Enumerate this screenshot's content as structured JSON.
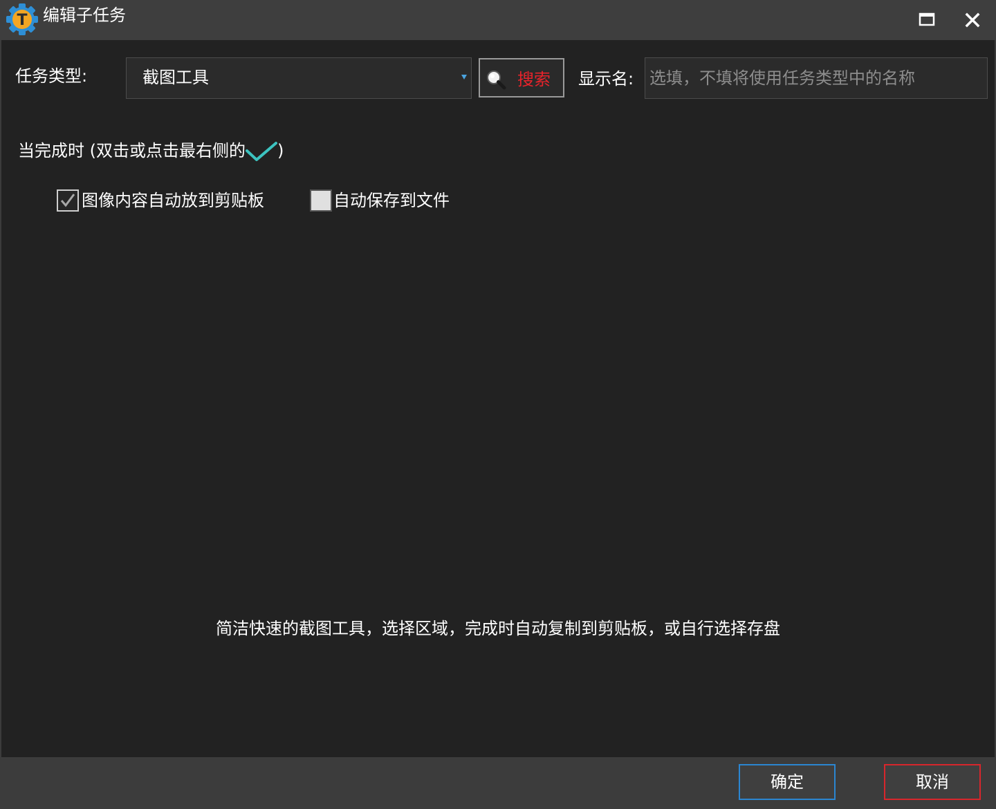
{
  "window": {
    "title": "编辑子任务",
    "app_icon": "t-gear-app-icon",
    "app_icon_letter": "T",
    "controls": {
      "maximize_icon": "maximize-icon",
      "close_icon": "close-icon"
    }
  },
  "form": {
    "task_type_label": "任务类型:",
    "task_type_value": "截图工具",
    "search_label": "搜索",
    "display_name_label": "显示名:",
    "display_name_value": "",
    "display_name_placeholder": "选填，不填将使用任务类型中的名称"
  },
  "completion": {
    "heading_prefix": "当完成时 (双击或点击最右侧的",
    "heading_suffix": ")",
    "options": [
      {
        "label": "图像内容自动放到剪贴板",
        "checked": true
      },
      {
        "label": "自动保存到文件",
        "checked": false
      }
    ]
  },
  "description": "简洁快速的截图工具，选择区域，完成时自动复制到剪贴板，或自行选择存盘",
  "footer": {
    "ok_label": "确定",
    "cancel_label": "取消"
  },
  "colors": {
    "accent_blue": "#2b86d1",
    "danger_red": "#d8262c",
    "search_text_red": "#e8232b",
    "check_teal": "#3cc3c0",
    "content_bg": "#222222",
    "chrome_bg": "#3c3c3c"
  }
}
